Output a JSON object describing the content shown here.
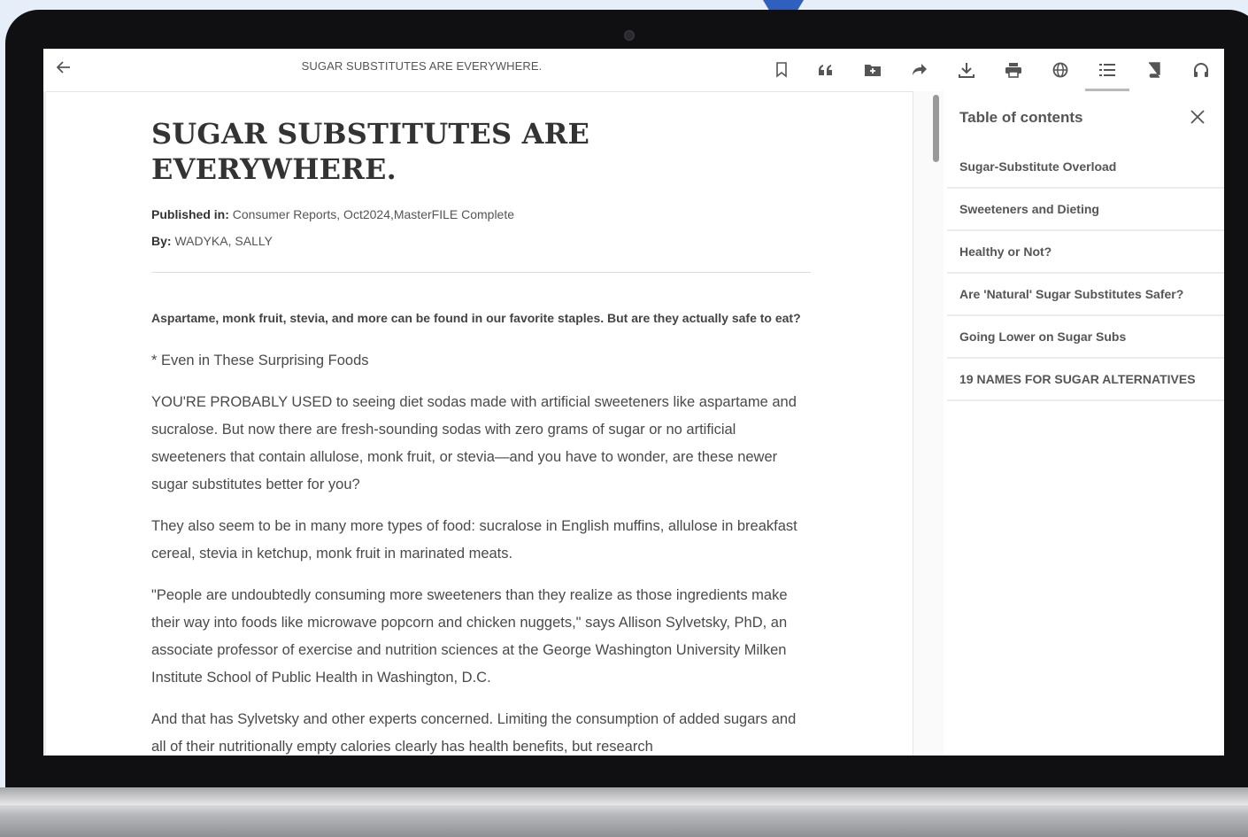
{
  "reader": {
    "doc_title": "SUGAR SUBSTITUTES ARE EVERYWHERE.",
    "toolbar_icons": [
      "arrow-left-icon",
      "bookmark-icon",
      "quote-icon",
      "folder-add-icon",
      "share-icon",
      "download-icon",
      "print-icon",
      "globe-icon",
      "list-icon",
      "book-icon",
      "headphones-icon"
    ],
    "active_tool": "list-icon"
  },
  "article": {
    "title": "SUGAR SUBSTITUTES ARE EVERYWHERE.",
    "published_label": "Published in:",
    "published_value": "Consumer Reports, Oct2024,MasterFILE Complete",
    "by_label": "By:",
    "by_value": "WADYKA, SALLY",
    "lede": "Aspartame, monk fruit, stevia, and more can be found in our favorite staples. But are they actually safe to eat?",
    "subhead": "* Even in These Surprising Foods",
    "paragraphs": [
      "YOU'RE PROBABLY USED to seeing diet sodas made with artificial sweeteners like aspartame and sucralose. But now there are fresh-sounding sodas with zero grams of sugar or no artificial sweeteners that contain allulose, monk fruit, or stevia—and you have to wonder, are these newer sugar substitutes better for you?",
      "They also seem to be in many more types of food: sucralose in English muffins, allulose in breakfast cereal, stevia in ketchup, monk fruit in marinated meats.",
      "\"People are undoubtedly consuming more sweeteners than they realize as those ingredients make their way into foods like microwave popcorn and chicken nuggets,\" says Allison Sylvetsky, PhD, an associate professor of exercise and nutrition sciences at the George Washington University Milken Institute School of Public Health in Washington, D.C.",
      "And that has Sylvetsky and other experts concerned. Limiting the consumption of added sugars and all of their nutritionally empty calories clearly has health benefits, but research"
    ]
  },
  "toc": {
    "title": "Table of contents",
    "items": [
      "Sugar-Substitute Overload",
      "Sweeteners and Dieting",
      "Healthy or Not?",
      "Are 'Natural' Sugar Substitutes Safer?",
      "Going Lower on Sugar Subs",
      "19 NAMES FOR SUGAR ALTERNATIVES"
    ]
  },
  "colors": {
    "page_background": "#e6eef9",
    "pointer": "#2f5fbf",
    "laptop_bezel": "#101012",
    "text_primary": "#333333",
    "text_secondary": "#555555"
  }
}
